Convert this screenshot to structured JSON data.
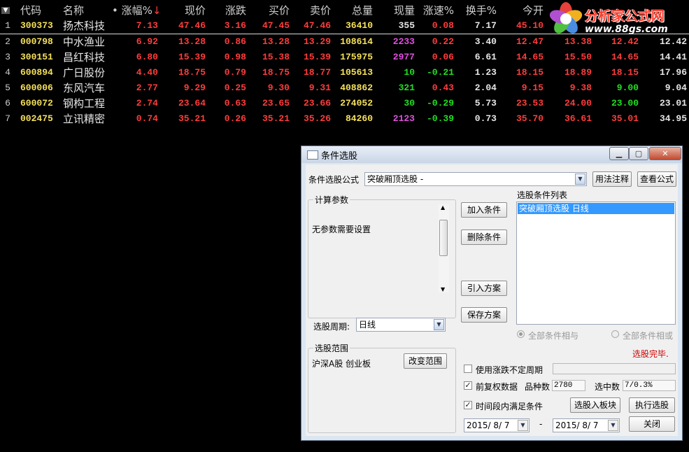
{
  "table": {
    "headers": [
      "代码",
      "名称",
      "涨幅%",
      "现价",
      "涨跌",
      "买价",
      "卖价",
      "总量",
      "现量",
      "涨速%",
      "换手%",
      "今开"
    ],
    "rows": [
      {
        "no": "1",
        "code": "300373",
        "name": "扬杰科技",
        "chg": "7.13",
        "price": "47.46",
        "delta": "3.16",
        "bid": "47.45",
        "ask": "47.46",
        "vol": "36410",
        "cur": "355",
        "speed": "0.08",
        "turn": "7.17",
        "open": "45.10",
        "high": "",
        "low": "",
        "prev": ""
      },
      {
        "no": "2",
        "code": "000798",
        "name": "中水渔业",
        "chg": "6.92",
        "price": "13.28",
        "delta": "0.86",
        "bid": "13.28",
        "ask": "13.29",
        "vol": "108614",
        "cur": "2233",
        "speed": "0.22",
        "turn": "3.40",
        "open": "12.47",
        "high": "13.38",
        "low": "12.42",
        "prev": "12.42"
      },
      {
        "no": "3",
        "code": "300151",
        "name": "昌红科技",
        "chg": "6.80",
        "price": "15.39",
        "delta": "0.98",
        "bid": "15.38",
        "ask": "15.39",
        "vol": "175975",
        "cur": "2977",
        "speed": "0.06",
        "turn": "6.61",
        "open": "14.65",
        "high": "15.50",
        "low": "14.65",
        "prev": "14.41"
      },
      {
        "no": "4",
        "code": "600894",
        "name": "广日股份",
        "chg": "4.40",
        "price": "18.75",
        "delta": "0.79",
        "bid": "18.75",
        "ask": "18.77",
        "vol": "105613",
        "cur": "10",
        "speed": "-0.21",
        "turn": "1.23",
        "open": "18.15",
        "high": "18.89",
        "low": "18.15",
        "prev": "17.96"
      },
      {
        "no": "5",
        "code": "600006",
        "name": "东风汽车",
        "chg": "2.77",
        "price": "9.29",
        "delta": "0.25",
        "bid": "9.30",
        "ask": "9.31",
        "vol": "408862",
        "cur": "321",
        "speed": "0.43",
        "turn": "2.04",
        "open": "9.15",
        "high": "9.38",
        "low": "9.00",
        "prev": "9.04"
      },
      {
        "no": "6",
        "code": "600072",
        "name": "钢构工程",
        "chg": "2.74",
        "price": "23.64",
        "delta": "0.63",
        "bid": "23.65",
        "ask": "23.66",
        "vol": "274052",
        "cur": "30",
        "speed": "-0.29",
        "turn": "5.73",
        "open": "23.53",
        "high": "24.00",
        "low": "23.00",
        "prev": "23.01"
      },
      {
        "no": "7",
        "code": "002475",
        "name": "立讯精密",
        "chg": "0.74",
        "price": "35.21",
        "delta": "0.26",
        "bid": "35.21",
        "ask": "35.26",
        "vol": "84260",
        "cur": "2123",
        "speed": "-0.39",
        "turn": "0.73",
        "open": "35.70",
        "high": "36.61",
        "low": "35.01",
        "prev": "34.95"
      }
    ]
  },
  "logo": {
    "title": "分析家公式网",
    "url": "www.88gs.com"
  },
  "dialog": {
    "title": "条件选股",
    "formula_label": "条件选股公式",
    "formula_value": "突破厢顶选股 -",
    "usage_btn": "用法注释",
    "view_formula_btn": "查看公式",
    "params_group": "计算参数",
    "params_text": "无参数需要设置",
    "period_label": "选股周期:",
    "period_value": "日线",
    "add_btn": "加入条件",
    "delete_btn": "删除条件",
    "import_btn": "引入方案",
    "save_btn": "保存方案",
    "list_label": "选股条件列表",
    "list_item": "突破厢顶选股  日线",
    "radio_and": "全部条件相与",
    "radio_or": "全部条件相或",
    "status": "选股完毕.",
    "range_group": "选股范围",
    "range_value": "沪深A股 创业板",
    "change_range_btn": "改变范围",
    "chk_uncertain": "使用涨跌不定周期",
    "chk_adjust": "前复权数据",
    "count_label": "品种数",
    "count_value": "2780",
    "selected_label": "选中数",
    "selected_value": "7/0.3%",
    "chk_period": "时间段内满足条件",
    "to_block_btn": "选股入板块",
    "run_btn": "执行选股",
    "date_from": "2015/ 8/ 7",
    "date_sep": "-",
    "date_to": "2015/ 8/ 7",
    "close_btn": "关闭"
  }
}
